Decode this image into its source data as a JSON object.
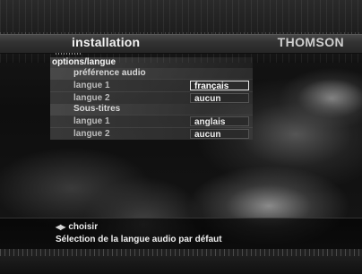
{
  "header": {
    "title": "installation",
    "brand": "THOMSON"
  },
  "menu": {
    "title": "options/langue",
    "sections": [
      {
        "label": "préférence audio",
        "rows": [
          {
            "label": "langue 1",
            "value": "français",
            "selected": true
          },
          {
            "label": "langue 2",
            "value": "aucun",
            "selected": false
          }
        ]
      },
      {
        "label": "Sous-titres",
        "rows": [
          {
            "label": "langue 1",
            "value": "anglais",
            "selected": false
          },
          {
            "label": "langue 2",
            "value": "aucun",
            "selected": false
          }
        ]
      }
    ]
  },
  "footer": {
    "nav_icon": "left-right-arrows-icon",
    "nav_label": "choisir",
    "help_text": "Sélection de la langue audio par défaut"
  },
  "colors": {
    "selected_border": "#e8e8e8",
    "background": "#111111"
  }
}
